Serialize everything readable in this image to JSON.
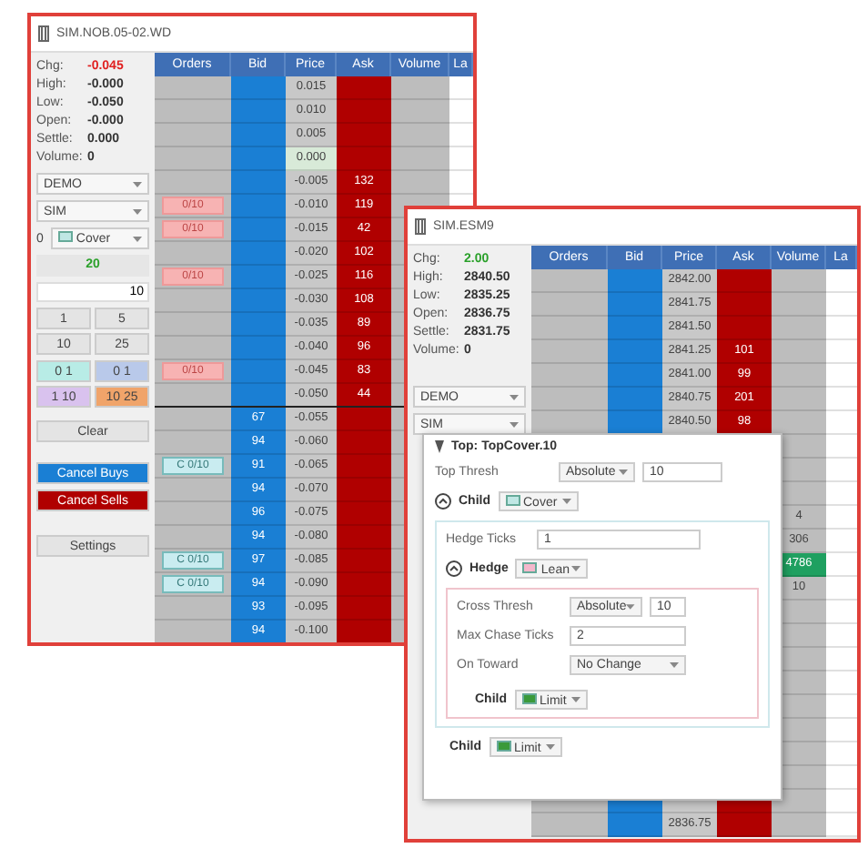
{
  "back_window": {
    "title": "SIM.NOB.05-02.WD",
    "stats": [
      {
        "label": "Chg:",
        "value": "-0.045",
        "color": "#e02020"
      },
      {
        "label": "High:",
        "value": "-0.000",
        "color": "#333333"
      },
      {
        "label": "Low:",
        "value": "-0.050",
        "color": "#333333"
      },
      {
        "label": "Open:",
        "value": "-0.000",
        "color": "#333333"
      },
      {
        "label": "Settle:",
        "value": "0.000",
        "color": "#333333"
      },
      {
        "label": "Volume:",
        "value": "0",
        "color": "#333333"
      }
    ],
    "account": "DEMO",
    "route": "SIM",
    "strategy_count": "0",
    "strategy": {
      "order_type": "Cover",
      "color": "#bfe7e4"
    },
    "quantity": "20",
    "quantity_input": "10",
    "qty_buttons": [
      "1",
      "5",
      "10",
      "25"
    ],
    "preset_buttons": [
      {
        "label": "0 1",
        "color": "#b8ece6"
      },
      {
        "label": "0 1",
        "color": "#b9c9ea"
      },
      {
        "label": "1 10",
        "color": "#d9c2ee"
      },
      {
        "label": "10 25",
        "color": "#f0a46a"
      }
    ],
    "clear": "Clear",
    "cancel_buys": "Cancel Buys",
    "cancel_sells": "Cancel Sells",
    "settings": "Settings",
    "columns": [
      "Orders",
      "Bid",
      "Price",
      "Ask",
      "Volume",
      "La"
    ],
    "rows": [
      {
        "price": "0.015",
        "bid": "",
        "ask": "",
        "last": false
      },
      {
        "price": "0.010",
        "bid": "",
        "ask": "",
        "last": false
      },
      {
        "price": "0.005",
        "bid": "",
        "ask": "",
        "last": false
      },
      {
        "price": "0.000",
        "bid": "",
        "ask": "",
        "last": true
      },
      {
        "price": "-0.005",
        "bid": "",
        "ask": "132",
        "last": false
      },
      {
        "price": "-0.010",
        "bid": "",
        "ask": "119",
        "last": false,
        "order": {
          "kind": "sell",
          "label": "0/10"
        }
      },
      {
        "price": "-0.015",
        "bid": "",
        "ask": "42",
        "last": false,
        "order": {
          "kind": "sell",
          "label": "0/10"
        }
      },
      {
        "price": "-0.020",
        "bid": "",
        "ask": "102",
        "last": false
      },
      {
        "price": "-0.025",
        "bid": "",
        "ask": "116",
        "last": false,
        "order": {
          "kind": "sell",
          "label": "0/10"
        }
      },
      {
        "price": "-0.030",
        "bid": "",
        "ask": "108",
        "last": false
      },
      {
        "price": "-0.035",
        "bid": "",
        "ask": "89",
        "last": false
      },
      {
        "price": "-0.040",
        "bid": "",
        "ask": "96",
        "last": false
      },
      {
        "price": "-0.045",
        "bid": "",
        "ask": "83",
        "last": false,
        "order": {
          "kind": "sell",
          "label": "0/10"
        }
      },
      {
        "price": "-0.050",
        "bid": "",
        "ask": "44",
        "last": false
      },
      {
        "price": "-0.055",
        "bid": "67",
        "ask": "",
        "last": false
      },
      {
        "price": "-0.060",
        "bid": "94",
        "ask": "",
        "last": false
      },
      {
        "price": "-0.065",
        "bid": "91",
        "ask": "",
        "last": false,
        "order": {
          "kind": "cover",
          "label": "C 0/10"
        }
      },
      {
        "price": "-0.070",
        "bid": "94",
        "ask": "",
        "last": false
      },
      {
        "price": "-0.075",
        "bid": "96",
        "ask": "",
        "last": false
      },
      {
        "price": "-0.080",
        "bid": "94",
        "ask": "",
        "last": false
      },
      {
        "price": "-0.085",
        "bid": "97",
        "ask": "",
        "last": false,
        "order": {
          "kind": "cover",
          "label": "C 0/10"
        }
      },
      {
        "price": "-0.090",
        "bid": "94",
        "ask": "",
        "last": false,
        "order": {
          "kind": "cover",
          "label": "C 0/10"
        }
      },
      {
        "price": "-0.095",
        "bid": "93",
        "ask": "",
        "last": false
      },
      {
        "price": "-0.100",
        "bid": "94",
        "ask": "",
        "last": false
      }
    ]
  },
  "front_window": {
    "title": "SIM.ESM9",
    "stats": [
      {
        "label": "Chg:",
        "value": "2.00",
        "color": "#2aa02a"
      },
      {
        "label": "High:",
        "value": "2840.50",
        "color": "#333333"
      },
      {
        "label": "Low:",
        "value": "2835.25",
        "color": "#333333"
      },
      {
        "label": "Open:",
        "value": "2836.75",
        "color": "#333333"
      },
      {
        "label": "Settle:",
        "value": "2831.75",
        "color": "#333333"
      },
      {
        "label": "Volume:",
        "value": "0",
        "color": "#333333"
      }
    ],
    "account": "DEMO",
    "route": "SIM",
    "columns": [
      "Orders",
      "Bid",
      "Price",
      "Ask",
      "Volume",
      "La"
    ],
    "rows": [
      {
        "price": "2842.00",
        "ask": "",
        "volume": "",
        "last": false
      },
      {
        "price": "2841.75",
        "ask": "",
        "volume": "",
        "last": false
      },
      {
        "price": "2841.50",
        "ask": "",
        "volume": "",
        "last": false
      },
      {
        "price": "2841.25",
        "ask": "101",
        "volume": "",
        "last": false
      },
      {
        "price": "2841.00",
        "ask": "99",
        "volume": "",
        "last": false
      },
      {
        "price": "2840.75",
        "ask": "201",
        "volume": "",
        "last": false
      },
      {
        "price": "2840.50",
        "ask": "98",
        "volume": "",
        "last": false
      },
      {
        "price": "",
        "ask": "",
        "volume": "",
        "last": false
      },
      {
        "price": "",
        "ask": "",
        "volume": "",
        "last": false
      },
      {
        "price": "",
        "ask": "",
        "volume": "",
        "last": false
      },
      {
        "price": "",
        "ask": "",
        "volume": "4",
        "last": false
      },
      {
        "price": "",
        "ask": "",
        "volume": "306",
        "last": false
      },
      {
        "price": "",
        "ask": "",
        "volume": "4786",
        "last": true
      },
      {
        "price": "",
        "ask": "",
        "volume": "10",
        "last": false
      },
      {
        "price": "",
        "ask": "",
        "volume": "",
        "last": false
      },
      {
        "price": "",
        "ask": "",
        "volume": "",
        "last": false
      },
      {
        "price": "",
        "ask": "",
        "volume": "",
        "last": false
      },
      {
        "price": "",
        "ask": "",
        "volume": "",
        "last": false
      },
      {
        "price": "",
        "ask": "",
        "volume": "",
        "last": false
      },
      {
        "price": "",
        "ask": "",
        "volume": "",
        "last": false
      },
      {
        "price": "",
        "ask": "",
        "volume": "",
        "last": false
      },
      {
        "price": "",
        "ask": "",
        "volume": "",
        "last": false
      },
      {
        "price": "",
        "ask": "",
        "volume": "",
        "last": false
      },
      {
        "price": "2836.75",
        "ask": "",
        "volume": "",
        "last": false
      }
    ]
  },
  "dialog": {
    "title": "Top: TopCover.10",
    "top_thresh": {
      "label": "Top Thresh",
      "mode": "Absolute",
      "value": "10"
    },
    "child": {
      "label": "Child",
      "order_type": "Cover",
      "color": "#bfe7e4",
      "hedge_ticks": {
        "label": "Hedge Ticks",
        "value": "1"
      },
      "hedge": {
        "label": "Hedge",
        "order_type": "Lean",
        "color": "#f4b8cc",
        "cross_thresh": {
          "label": "Cross Thresh",
          "mode": "Absolute",
          "value": "10"
        },
        "max_chase_ticks": {
          "label": "Max Chase Ticks",
          "value": "2"
        },
        "on_toward": {
          "label": "On Toward",
          "value": "No Change"
        },
        "child": {
          "label": "Child",
          "order_type": "Limit",
          "color": "#3a9a3a"
        }
      }
    },
    "last_child": {
      "label": "Child",
      "order_type": "Limit",
      "color": "#3a9a3a"
    }
  }
}
